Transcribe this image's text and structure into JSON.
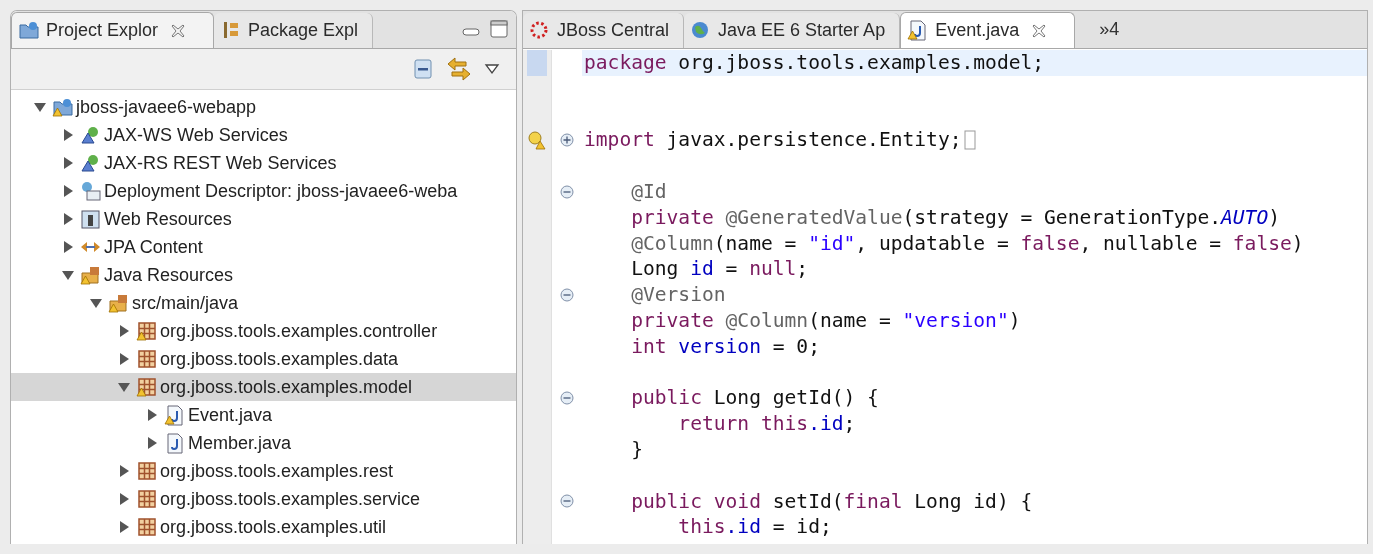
{
  "explorer": {
    "tabs": [
      {
        "label": "Project Explor",
        "kind": "project",
        "warning": false,
        "selected": true
      },
      {
        "label": "Package Expl",
        "kind": "packageview",
        "warning": false,
        "selected": false
      }
    ],
    "tree": [
      {
        "label": "jboss-javaee6-webapp",
        "kind": "project",
        "warning": true,
        "expanded": true,
        "selected": false,
        "children": [
          {
            "label": "JAX-WS Web Services",
            "kind": "webservice",
            "warning": false,
            "expanded": false,
            "selected": false
          },
          {
            "label": "JAX-RS REST Web Services",
            "kind": "webservice",
            "warning": false,
            "expanded": false,
            "selected": false
          },
          {
            "label": "Deployment Descriptor: jboss-javaee6-weba",
            "kind": "descriptor",
            "warning": false,
            "expanded": false,
            "selected": false
          },
          {
            "label": "Web Resources",
            "kind": "webres",
            "warning": false,
            "expanded": false,
            "selected": false
          },
          {
            "label": "JPA Content",
            "kind": "jpa",
            "warning": false,
            "expanded": false,
            "selected": false
          },
          {
            "label": "Java Resources",
            "kind": "srcfolder",
            "warning": true,
            "expanded": true,
            "selected": false,
            "children": [
              {
                "label": "src/main/java",
                "kind": "srcfolder",
                "warning": true,
                "expanded": true,
                "selected": false,
                "children": [
                  {
                    "label": "org.jboss.tools.examples.controller",
                    "kind": "package",
                    "warning": true,
                    "expanded": false,
                    "selected": false
                  },
                  {
                    "label": "org.jboss.tools.examples.data",
                    "kind": "package",
                    "warning": false,
                    "expanded": false,
                    "selected": false
                  },
                  {
                    "label": "org.jboss.tools.examples.model",
                    "kind": "package",
                    "warning": true,
                    "expanded": true,
                    "selected": true,
                    "children": [
                      {
                        "label": "Event.java",
                        "kind": "java",
                        "warning": true,
                        "expanded": false,
                        "selected": false
                      },
                      {
                        "label": "Member.java",
                        "kind": "java",
                        "warning": false,
                        "expanded": false,
                        "selected": false
                      }
                    ]
                  },
                  {
                    "label": "org.jboss.tools.examples.rest",
                    "kind": "package",
                    "warning": false,
                    "expanded": false,
                    "selected": false
                  },
                  {
                    "label": "org.jboss.tools.examples.service",
                    "kind": "package",
                    "warning": false,
                    "expanded": false,
                    "selected": false
                  },
                  {
                    "label": "org.jboss.tools.examples.util",
                    "kind": "package",
                    "warning": false,
                    "expanded": false,
                    "selected": false
                  }
                ]
              }
            ]
          }
        ]
      }
    ]
  },
  "editor": {
    "tabs": [
      {
        "label": "JBoss Central",
        "kind": "central",
        "warning": false,
        "selected": false
      },
      {
        "label": "Java EE 6 Starter Ap",
        "kind": "globe",
        "warning": false,
        "selected": false
      },
      {
        "label": "Event.java",
        "kind": "java",
        "warning": true,
        "selected": true
      }
    ],
    "overflow": "»4",
    "lines": [
      {
        "kind": "code",
        "current": true,
        "segments": [
          {
            "kind": "keyword",
            "t": "package"
          },
          {
            "kind": "plain",
            "t": " org.jboss.tools.examples.model;"
          }
        ]
      },
      {
        "kind": "blank"
      },
      {
        "kind": "blank"
      },
      {
        "kind": "code",
        "warning": true,
        "expanded": false,
        "segments": [
          {
            "kind": "keyword",
            "t": "import"
          },
          {
            "kind": "plain",
            "t": " javax.persistence.Entity;"
          }
        ]
      },
      {
        "kind": "blank"
      },
      {
        "kind": "code",
        "expanded": true,
        "segments": [
          {
            "kind": "annotation",
            "t": "    @Id"
          }
        ]
      },
      {
        "kind": "code",
        "segments": [
          {
            "kind": "keyword",
            "t": "    private"
          },
          {
            "kind": "annotation",
            "t": " @GeneratedValue"
          },
          {
            "kind": "plain",
            "t": "(strategy = GenerationType."
          },
          {
            "kind": "static",
            "t": "AUTO"
          },
          {
            "kind": "plain",
            "t": ")"
          }
        ]
      },
      {
        "kind": "code",
        "segments": [
          {
            "kind": "annotation",
            "t": "    @Column"
          },
          {
            "kind": "plain",
            "t": "(name = "
          },
          {
            "kind": "string",
            "t": "\"id\""
          },
          {
            "kind": "plain",
            "t": ", updatable = "
          },
          {
            "kind": "keyword",
            "t": "false"
          },
          {
            "kind": "plain",
            "t": ", nullable = "
          },
          {
            "kind": "keyword",
            "t": "false"
          },
          {
            "kind": "plain",
            "t": ")"
          }
        ]
      },
      {
        "kind": "code",
        "segments": [
          {
            "kind": "plain",
            "t": "    Long "
          },
          {
            "kind": "field",
            "t": "id"
          },
          {
            "kind": "plain",
            "t": " = "
          },
          {
            "kind": "keyword",
            "t": "null"
          },
          {
            "kind": "plain",
            "t": ";"
          }
        ]
      },
      {
        "kind": "code",
        "expanded": true,
        "segments": [
          {
            "kind": "annotation",
            "t": "    @Version"
          }
        ]
      },
      {
        "kind": "code",
        "segments": [
          {
            "kind": "keyword",
            "t": "    private"
          },
          {
            "kind": "annotation",
            "t": " @Column"
          },
          {
            "kind": "plain",
            "t": "(name = "
          },
          {
            "kind": "string",
            "t": "\"version\""
          },
          {
            "kind": "plain",
            "t": ")"
          }
        ]
      },
      {
        "kind": "code",
        "segments": [
          {
            "kind": "keyword",
            "t": "    int"
          },
          {
            "kind": "field",
            "t": " version"
          },
          {
            "kind": "plain",
            "t": " = 0;"
          }
        ]
      },
      {
        "kind": "blank"
      },
      {
        "kind": "code",
        "expanded": true,
        "segments": [
          {
            "kind": "keyword",
            "t": "    public"
          },
          {
            "kind": "plain",
            "t": " Long getId() {"
          }
        ]
      },
      {
        "kind": "code",
        "segments": [
          {
            "kind": "keyword",
            "t": "        return this"
          },
          {
            "kind": "field",
            "t": ".id"
          },
          {
            "kind": "plain",
            "t": ";"
          }
        ]
      },
      {
        "kind": "code",
        "segments": [
          {
            "kind": "plain",
            "t": "    }"
          }
        ]
      },
      {
        "kind": "blank"
      },
      {
        "kind": "code",
        "expanded": true,
        "segments": [
          {
            "kind": "keyword",
            "t": "    public void"
          },
          {
            "kind": "plain",
            "t": " setId("
          },
          {
            "kind": "keyword",
            "t": "final"
          },
          {
            "kind": "plain",
            "t": " Long id) {"
          }
        ]
      },
      {
        "kind": "code",
        "segments": [
          {
            "kind": "keyword",
            "t": "        this"
          },
          {
            "kind": "field",
            "t": ".id"
          },
          {
            "kind": "plain",
            "t": " = id;"
          }
        ]
      }
    ]
  }
}
